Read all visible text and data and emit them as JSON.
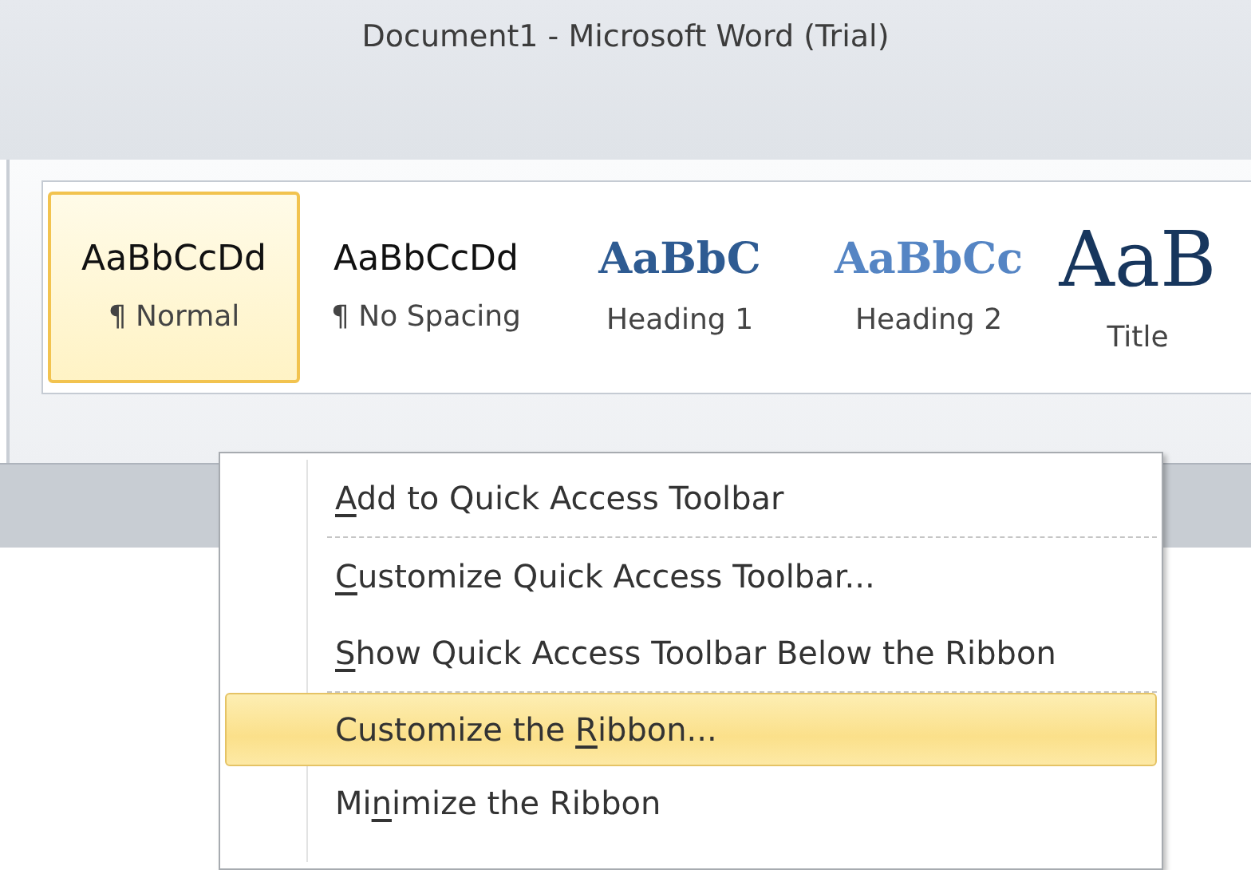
{
  "window": {
    "title": "Document1  -  Microsoft Word (Trial)"
  },
  "styles_gallery": [
    {
      "preview": "AaBbCcDd",
      "label": "¶ Normal",
      "kind": "body",
      "selected": true
    },
    {
      "preview": "AaBbCcDd",
      "label": "¶ No Spacing",
      "kind": "body",
      "selected": false
    },
    {
      "preview": "AaBbC",
      "label": "Heading 1",
      "kind": "heading1",
      "selected": false
    },
    {
      "preview": "AaBbCc",
      "label": "Heading 2",
      "kind": "heading2",
      "selected": false
    },
    {
      "preview": "AaB",
      "label": "Title",
      "kind": "title",
      "selected": false
    }
  ],
  "context_menu": [
    {
      "key": "A",
      "after": "dd to Quick Access Toolbar",
      "selected": false,
      "separator_after": true
    },
    {
      "key": "C",
      "after": "ustomize Quick Access Toolbar...",
      "selected": false,
      "separator_after": false
    },
    {
      "key": "S",
      "after": "how Quick Access Toolbar Below the Ribbon",
      "selected": false,
      "separator_after": true
    },
    {
      "before": "Customize the ",
      "key": "R",
      "after": "ibbon...",
      "selected": true,
      "separator_after": false
    },
    {
      "before": "Mi",
      "key": "n",
      "after": "imize the Ribbon",
      "selected": false,
      "separator_after": false
    }
  ]
}
